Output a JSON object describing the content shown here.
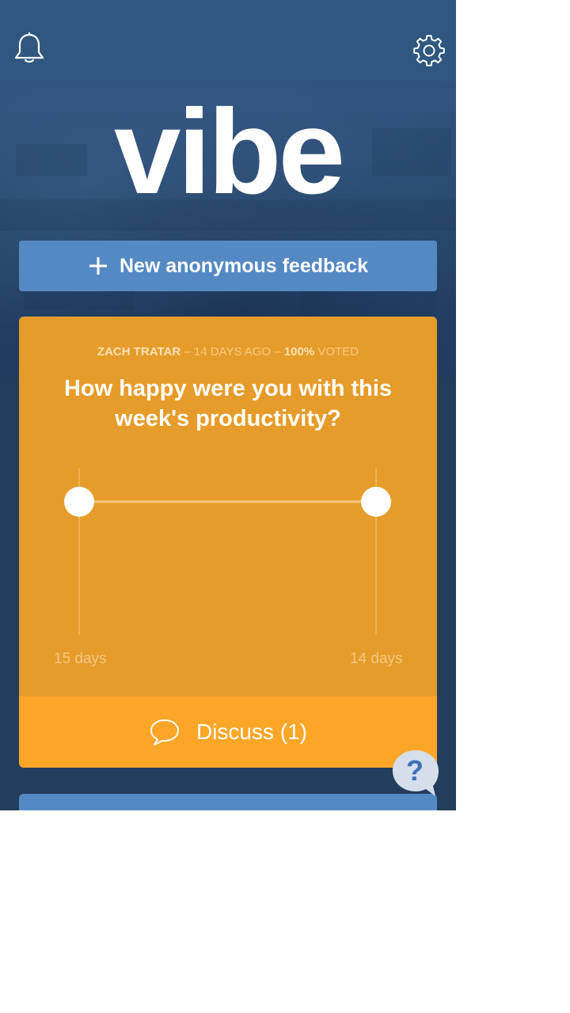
{
  "header": {
    "bell_icon": "bell-icon",
    "settings_icon": "gear-icon"
  },
  "brand": {
    "logo_text": "vibe"
  },
  "actions": {
    "new_feedback_label": "New anonymous feedback",
    "new_feedback_icon": "plus-icon"
  },
  "poll": {
    "author": "ZACH TRATAR",
    "separator": "–",
    "age": "14 DAYS AGO",
    "voted_percent": "100%",
    "voted_label": "VOTED",
    "question": "How happy were you with this week's productivity?",
    "discuss_label": "Discuss (1)",
    "discuss_icon": "speech-bubble-icon"
  },
  "chart_data": {
    "type": "line",
    "categories": [
      "15 days",
      "14 days"
    ],
    "series": [
      {
        "values": [
          1,
          1
        ]
      }
    ]
  },
  "help": {
    "label": "?",
    "icon": "help-bubble-icon"
  },
  "colors": {
    "topbar": "#2f577f",
    "background": "#233d5c",
    "button_blue": "#5589c4",
    "card_orange": "#e69c2a",
    "discuss_orange": "#fba627"
  }
}
